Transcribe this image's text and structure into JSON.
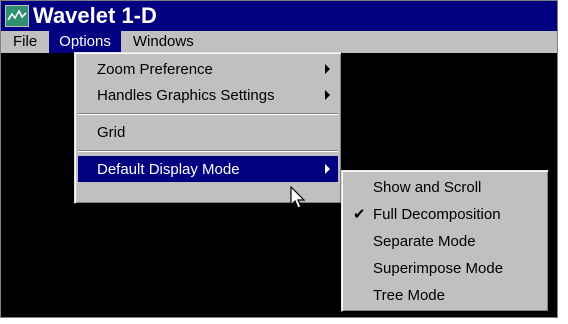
{
  "window": {
    "title": "Wavelet 1-D"
  },
  "menubar": {
    "file": "File",
    "options": "Options",
    "windows": "Windows"
  },
  "options_menu": {
    "zoom_preference": "Zoom Preference",
    "handles_graphics_settings": "Handles Graphics Settings",
    "grid": "Grid",
    "default_display_mode": "Default Display Mode"
  },
  "display_mode_menu": {
    "items": [
      {
        "label": "Show and Scroll",
        "checked": false
      },
      {
        "label": "Full Decomposition",
        "checked": true
      },
      {
        "label": "Separate Mode",
        "checked": false
      },
      {
        "label": "Superimpose Mode",
        "checked": false
      },
      {
        "label": "Tree Mode",
        "checked": false
      }
    ],
    "check_glyph": "✔"
  },
  "colors": {
    "title_bar": "#000080",
    "menu_bg": "#c0c0c0",
    "highlight": "#000080",
    "workspace": "#000000"
  },
  "icons": [
    "app-icon",
    "submenu-arrow-icon",
    "checkmark-icon",
    "mouse-pointer-icon"
  ]
}
